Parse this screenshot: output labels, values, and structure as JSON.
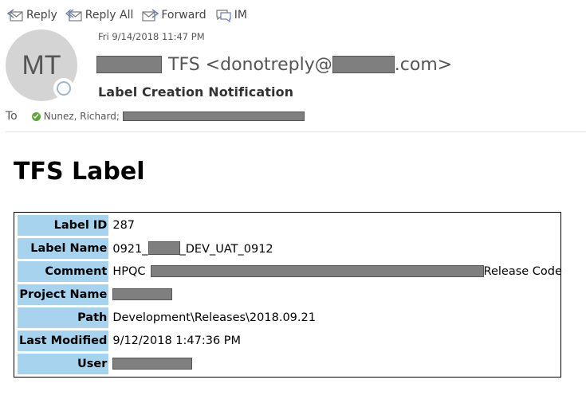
{
  "toolbar": {
    "reply": "Reply",
    "reply_all": "Reply All",
    "forward": "Forward",
    "im": "IM"
  },
  "sender": {
    "initials": "MT",
    "date": "Fri 9/14/2018 11:47 PM",
    "name_visible": "TFS",
    "email_prefix": "<donotreply@",
    "email_suffix": ".com>"
  },
  "subject": "Label Creation Notification",
  "to": {
    "label": "To",
    "recipient": "Nunez, Richard;"
  },
  "body": {
    "heading": "TFS Label",
    "rows": [
      {
        "label": "Label ID",
        "value": "287"
      },
      {
        "label": "Label Name",
        "value_prefix": "0921_",
        "value_suffix": "_DEV_UAT_0912"
      },
      {
        "label": "Comment",
        "value_prefix": "HPQC",
        "value_suffix": "Release Code"
      },
      {
        "label": "Project Name"
      },
      {
        "label": "Path",
        "value": "Development\\Releases\\2018.09.21"
      },
      {
        "label": "Last Modified",
        "value": "9/12/2018 1:47:36 PM"
      },
      {
        "label": "User"
      }
    ]
  },
  "icons": [
    "reply-icon",
    "reply-all-icon",
    "forward-icon",
    "im-icon",
    "presence-icon",
    "check-icon"
  ],
  "colors": {
    "label_cell": "#a7d3ee",
    "redaction": "#7f7f7f",
    "avatar": "#d4d4d4"
  }
}
